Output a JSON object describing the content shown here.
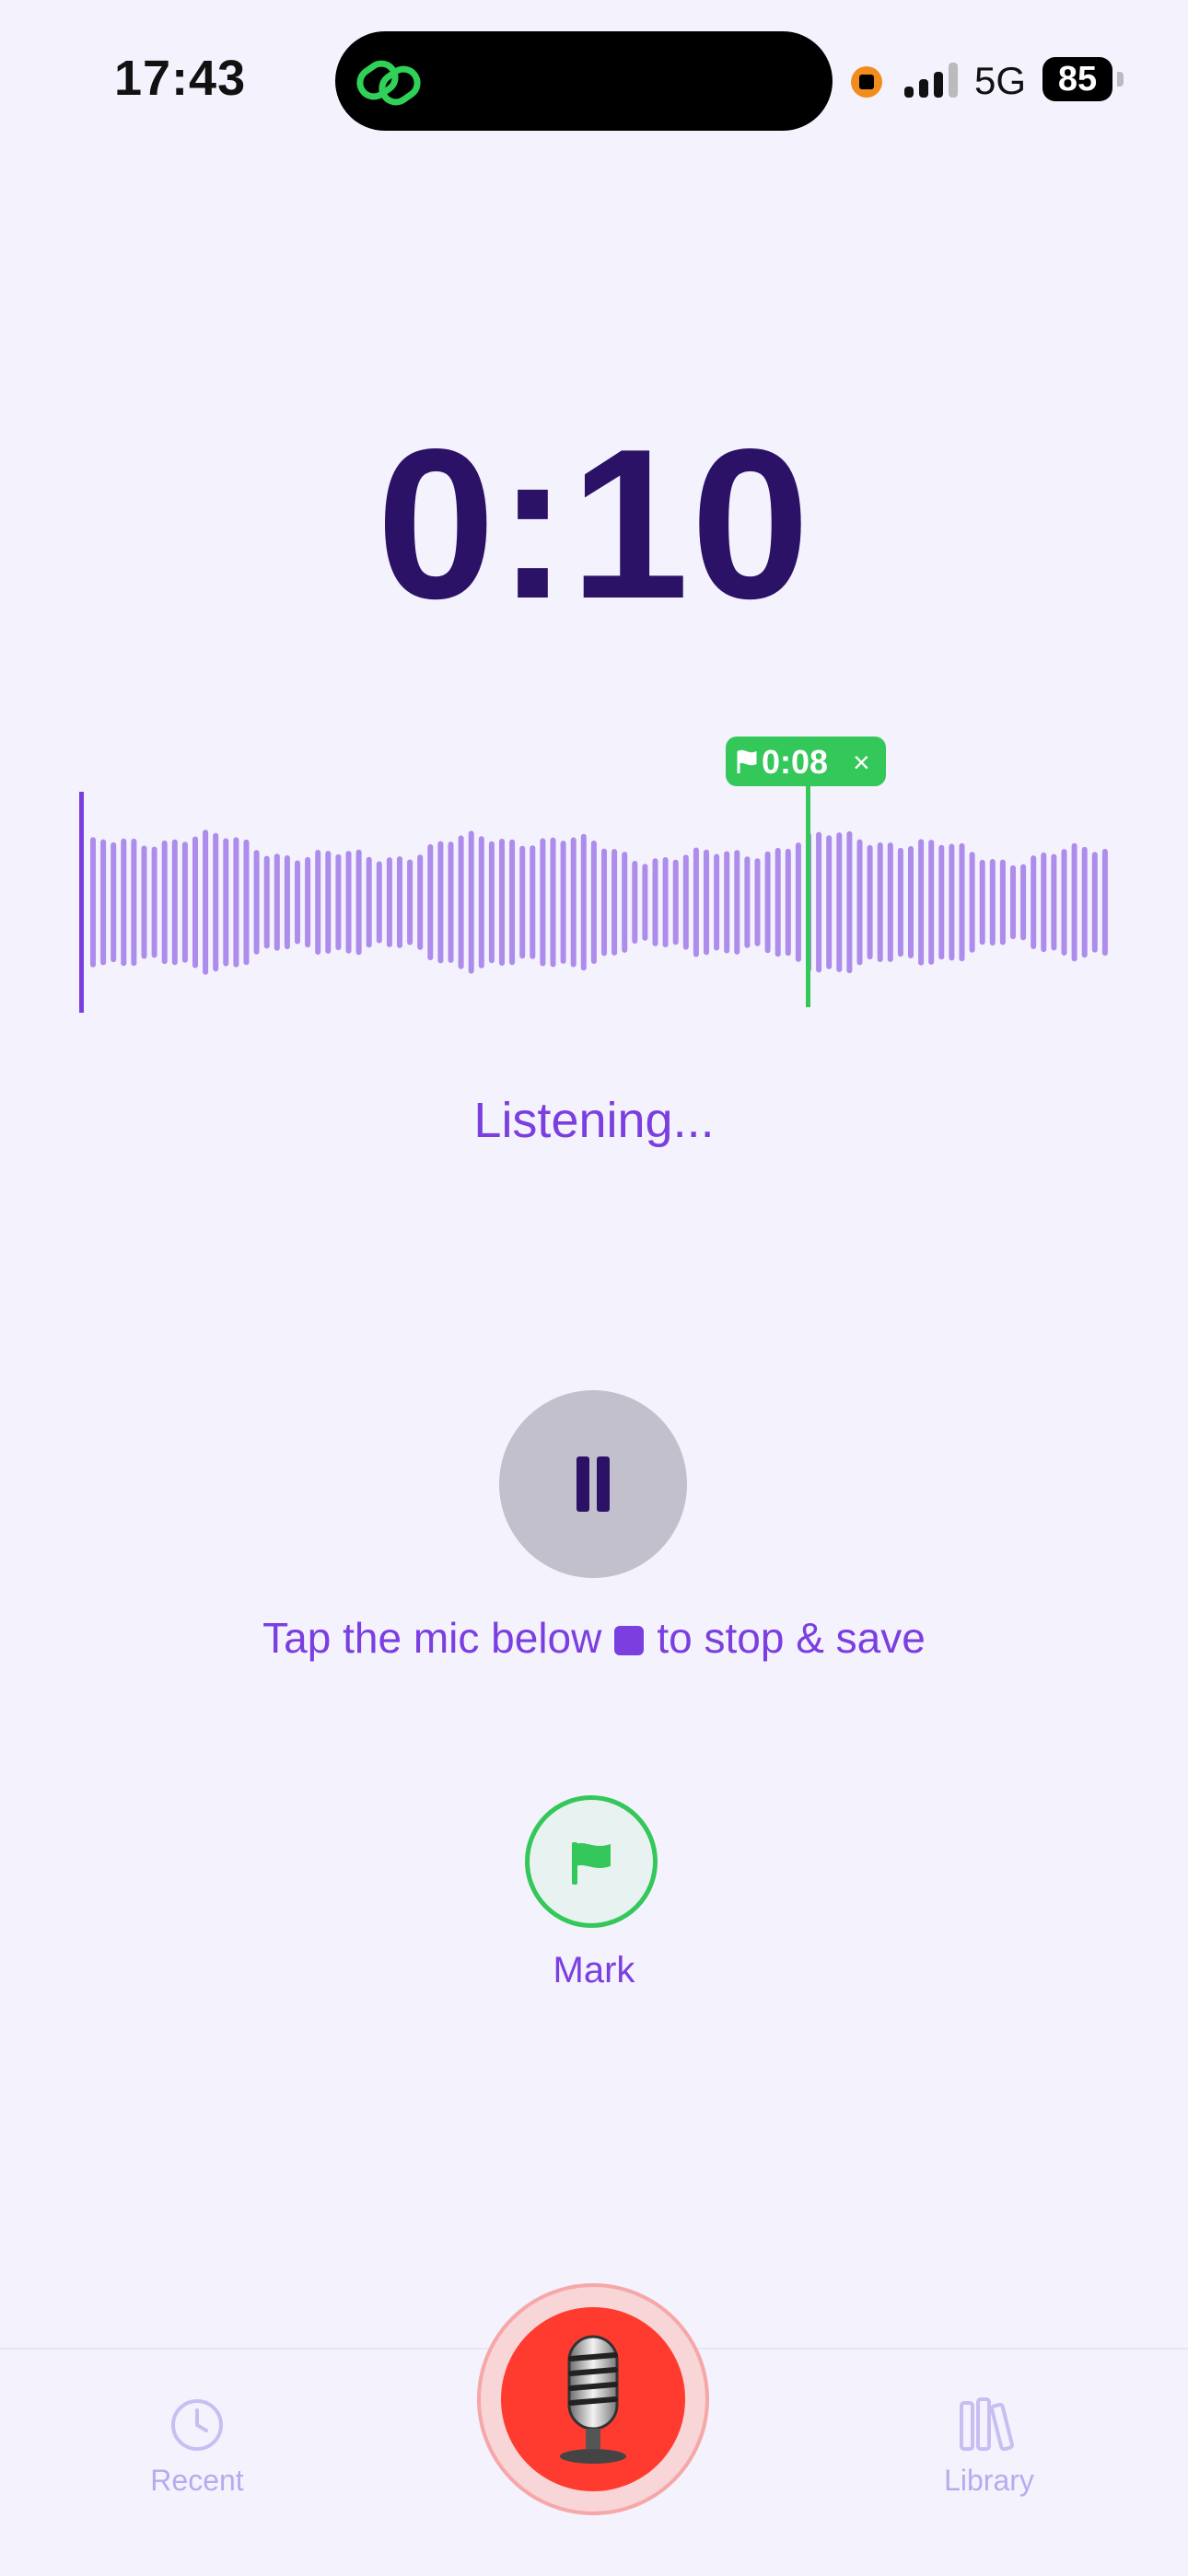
{
  "status_bar": {
    "time": "17:43",
    "network": "5G",
    "battery": "85",
    "accent_icon_color": "#30d158"
  },
  "recording": {
    "timer": "0:10",
    "status": "Listening...",
    "bookmark": {
      "time": "0:08",
      "close": "×",
      "color": "#34c759"
    },
    "waveform_color": "#ad8cec",
    "playhead_color": "#7b3fe0"
  },
  "controls": {
    "pause_icon": "pause-icon",
    "hint_before": "Tap the mic below",
    "hint_after": "to stop & save",
    "mark_label": "Mark",
    "mark_icon": "flag-icon"
  },
  "tabbar": {
    "recent_label": "Recent",
    "library_label": "Library",
    "record_color": "#ff3b30"
  }
}
